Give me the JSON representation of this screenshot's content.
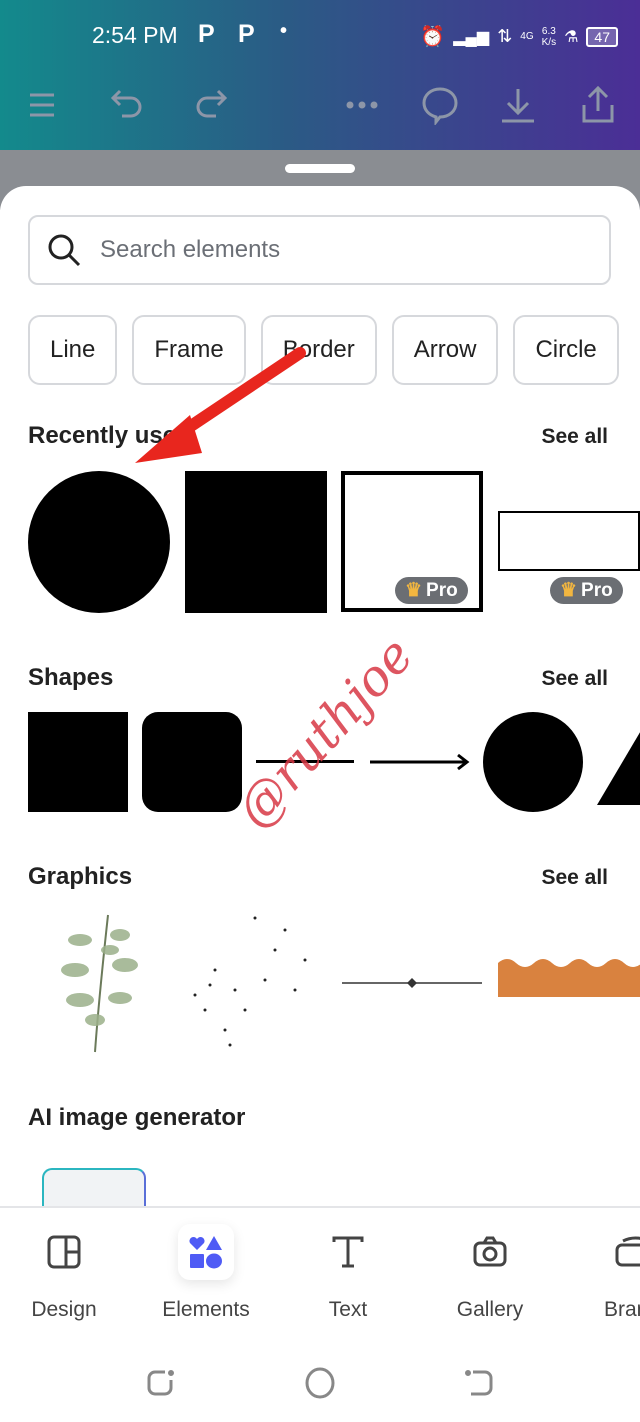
{
  "status": {
    "time": "2:54 PM",
    "p1": "P",
    "p2": "P",
    "dot": "•",
    "net_type": "4G",
    "speed": "6.3",
    "speed_unit": "K/s",
    "battery": "47"
  },
  "toolbar": {
    "icons": [
      "menu-icon",
      "undo-icon",
      "redo-icon",
      "more-icon",
      "comment-icon",
      "download-icon",
      "share-icon"
    ]
  },
  "search": {
    "placeholder": "Search elements"
  },
  "chips": [
    "Line",
    "Frame",
    "Border",
    "Arrow",
    "Circle"
  ],
  "recent": {
    "title": "Recently used",
    "see_all": "See all",
    "pro": "Pro"
  },
  "shapes": {
    "title": "Shapes",
    "see_all": "See all"
  },
  "graphics": {
    "title": "Graphics",
    "see_all": "See all"
  },
  "ai": {
    "title": "AI image generator"
  },
  "nav": [
    {
      "label": "Design"
    },
    {
      "label": "Elements",
      "selected": true
    },
    {
      "label": "Text"
    },
    {
      "label": "Gallery"
    },
    {
      "label": "Brand"
    }
  ],
  "colors": {
    "accent": "#4f5bf5",
    "annotation": "#e8261e"
  },
  "watermark": "@ruthjoe"
}
